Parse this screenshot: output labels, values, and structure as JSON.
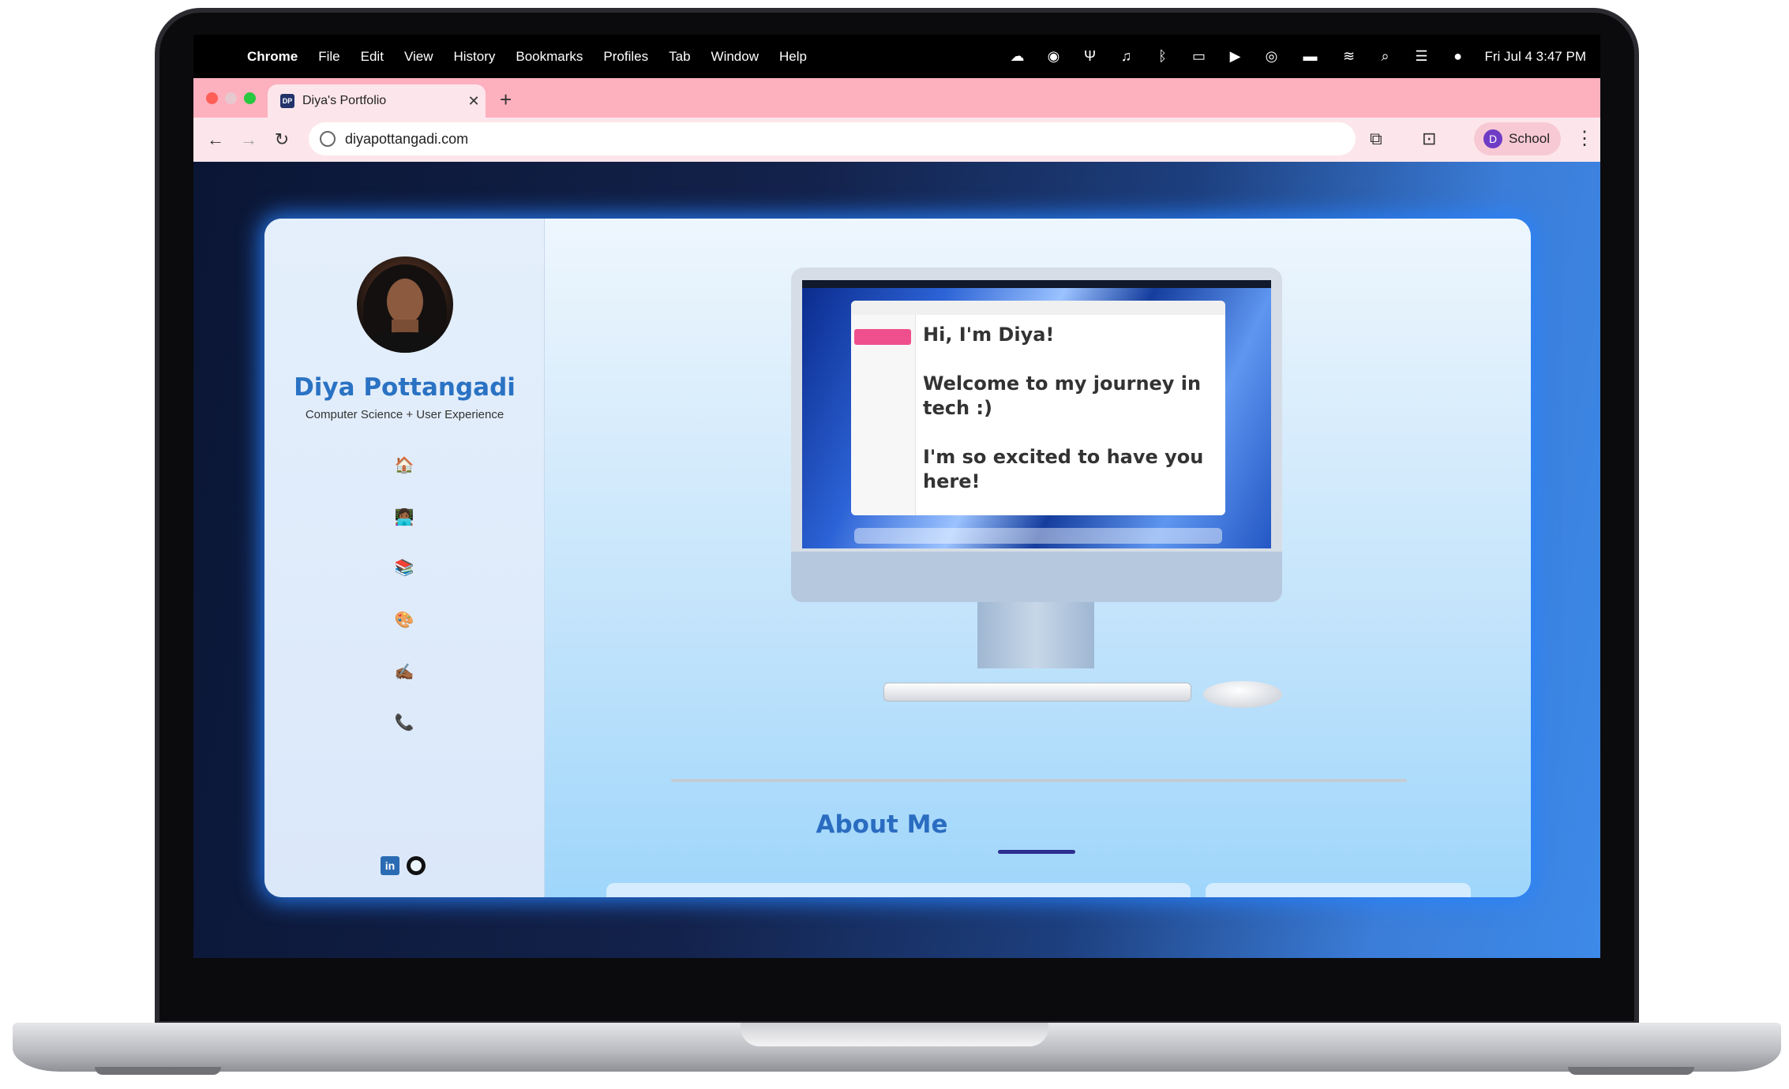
{
  "menubar": {
    "app_name": "Chrome",
    "items": [
      "File",
      "Edit",
      "View",
      "History",
      "Bookmarks",
      "Profiles",
      "Tab",
      "Window",
      "Help"
    ],
    "clock": "Fri Jul 4  3:47 PM",
    "tray_icons": [
      "creative-cloud-icon",
      "grammarly-icon",
      "fork-icon",
      "headset-icon",
      "bluetooth-icon",
      "window-icon",
      "play-icon",
      "airdrop-icon",
      "battery-icon",
      "wifi-icon",
      "search-icon",
      "control-center-icon",
      "siri-icon"
    ]
  },
  "browser": {
    "tab": {
      "favicon_text": "DP",
      "title": "Diya's Portfolio"
    },
    "address": "diyapottangadi.com",
    "profile": {
      "initial": "D",
      "name": "School"
    }
  },
  "page": {
    "sidebar": {
      "name": "Diya Pottangadi",
      "subtitle": "Computer Science + User Experience",
      "nav_icons": [
        "🏠",
        "👩🏾‍💻",
        "📚",
        "🎨",
        "✍🏾",
        "📞"
      ],
      "social": {
        "linkedin": "in",
        "github": "github"
      }
    },
    "hero": {
      "note_lines": [
        "Hi, I'm Diya!",
        "Welcome to my journey in tech :)",
        "I'm so excited to have you here!"
      ]
    },
    "about": {
      "heading": "About Me"
    }
  },
  "colors": {
    "name_blue": "#2a72c3",
    "heading_blue": "#2a6cc0",
    "tabstrip_pink": "#fdb0be",
    "card_glow": "#2882ff"
  }
}
